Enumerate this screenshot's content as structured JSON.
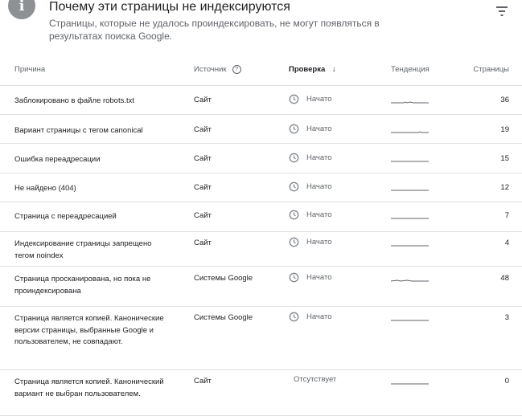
{
  "header": {
    "title": "Почему эти страницы не индексируются",
    "subtitle": "Страницы, которые не удалось проиндексировать, не могут появляться в результатах поиска Google.",
    "info_glyph": "i"
  },
  "table": {
    "columns": {
      "reason": "Причина",
      "source": "Источник",
      "help_glyph": "?",
      "check": "Проверка",
      "sort_glyph": "↓",
      "trend": "Тенденция",
      "pages": "Страницы"
    },
    "rows": [
      {
        "reason": "Заблокировано в файле robots.txt",
        "source": "Сайт",
        "status": "Начато",
        "pages": "36",
        "status_icon": "clock-icon"
      },
      {
        "reason": "Вариант страницы с тегом canonical",
        "source": "Сайт",
        "status": "Начато",
        "pages": "19",
        "status_icon": "clock-icon"
      },
      {
        "reason": "Ошибка переадресации",
        "source": "Сайт",
        "status": "Начато",
        "pages": "15",
        "status_icon": "clock-icon"
      },
      {
        "reason": "Не найдено (404)",
        "source": "Сайт",
        "status": "Начато",
        "pages": "12",
        "status_icon": "clock-icon"
      },
      {
        "reason": "Страница с переадресацией",
        "source": "Сайт",
        "status": "Начато",
        "pages": "7",
        "status_icon": "clock-icon"
      },
      {
        "reason": "Индексирование страницы запрещено тегом noindex",
        "source": "Сайт",
        "status": "Начато",
        "pages": "4",
        "status_icon": "clock-icon"
      },
      {
        "reason": "Страница просканирована, но пока не проиндексирована",
        "source": "Системы Google",
        "status": "Начато",
        "pages": "48",
        "status_icon": "clock-icon"
      },
      {
        "reason": "Страница является копией. Канонические версии страницы, выбранные Google и пользователем, не совпадают.",
        "source": "Системы Google",
        "status": "Начато",
        "pages": "3",
        "status_icon": "clock-icon"
      },
      {
        "reason": "Страница является копией. Канонический вариант не выбран пользователем.",
        "source": "Сайт",
        "status": "Отсутствует",
        "pages": "0",
        "status_icon": ""
      }
    ]
  },
  "colors": {
    "icon_gray": "#80868b",
    "divider": "#e0e0e0",
    "text_secondary": "#5f6368"
  }
}
